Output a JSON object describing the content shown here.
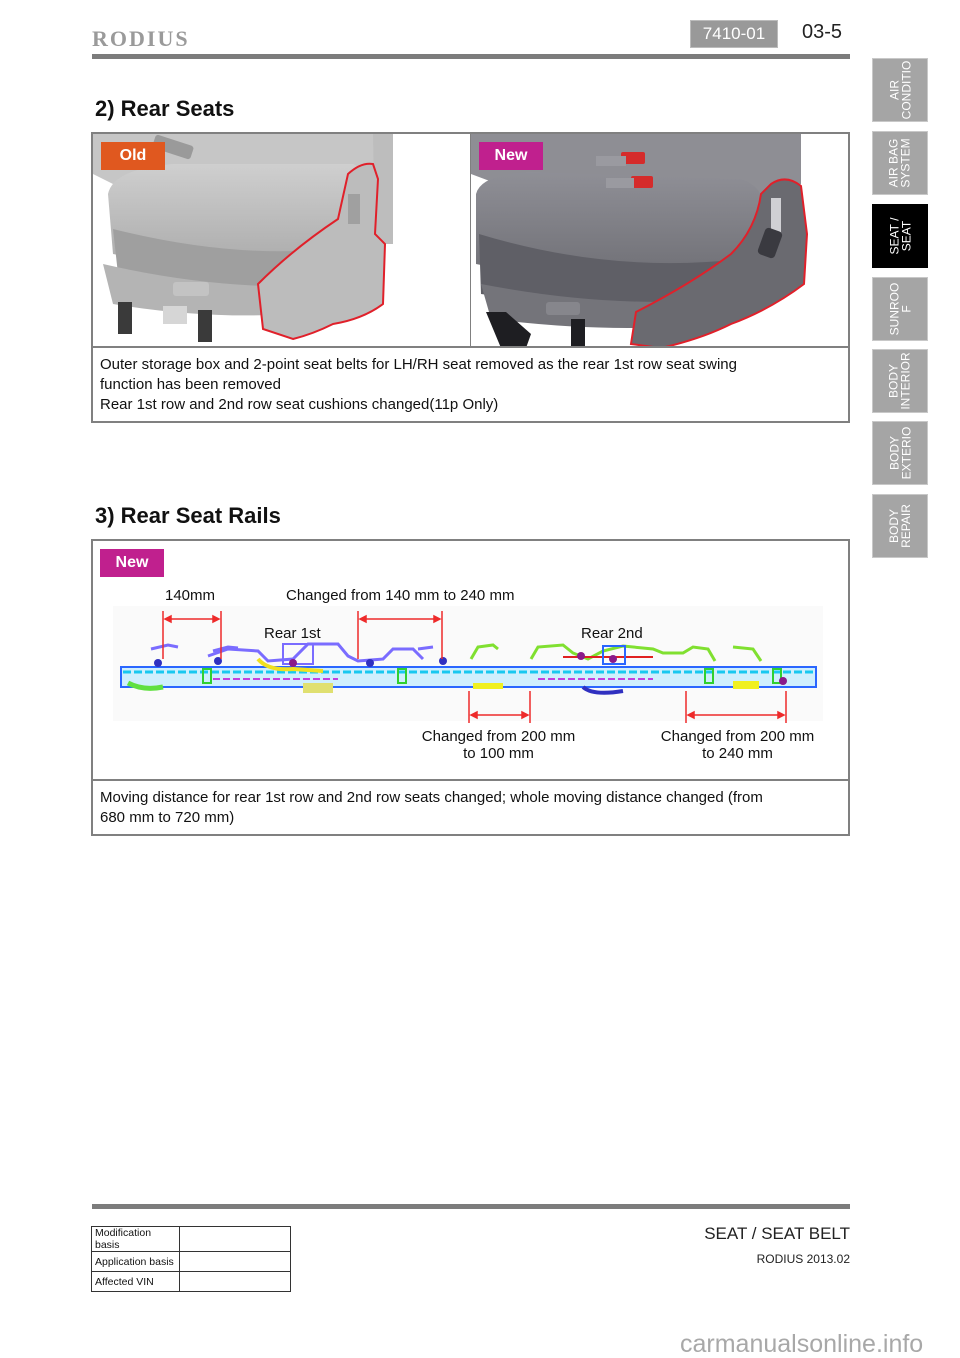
{
  "header": {
    "brand": "RODIUS",
    "code": "7410-01",
    "page": "03-5"
  },
  "side_tabs": [
    {
      "label": "AIR\nCONDITIO",
      "active": false
    },
    {
      "label": "AIR BAG\nSYSTEM",
      "active": false
    },
    {
      "label": "SEAT /\nSEAT",
      "active": true
    },
    {
      "label": "SUNROO\nF",
      "active": false
    },
    {
      "label": "BODY\nINTERIOR",
      "active": false
    },
    {
      "label": "BODY\nEXTERIO",
      "active": false
    },
    {
      "label": "BODY\nREPAIR",
      "active": false
    }
  ],
  "section_rear_seats": {
    "title": "2) Rear Seats",
    "old_tag": "Old",
    "new_tag": "New",
    "old_photo": "old-rear-seat-photo",
    "new_photo": "new-rear-seat-photo",
    "note_lines": [
      "Outer storage box and 2-point seat belts for LH/RH seat removed as the rear 1st row seat swing",
      "function has been removed",
      "Rear 1st row and 2nd row seat cushions changed(11p Only)"
    ]
  },
  "section_rear_rails": {
    "title": "3) Rear Seat Rails",
    "new_tag": "New",
    "labels": {
      "dim_140": "140mm",
      "changed_140_240": "Changed from 140 mm to 240 mm",
      "rear_1st": "Rear 1st",
      "rear_2nd": "Rear 2nd",
      "changed_200_100_l1": "Changed from 200 mm",
      "changed_200_100_l2": "to 100 mm",
      "changed_200_240_l1": "Changed from 200 mm",
      "changed_200_240_l2": "to 240 mm"
    },
    "note_lines": [
      "Moving distance for rear 1st row and 2nd row seats changed; whole moving distance changed (from",
      "680 mm to 720 mm)"
    ]
  },
  "footer": {
    "mod_table": [
      {
        "label": "Modification basis",
        "value": ""
      },
      {
        "label": "Application basis",
        "value": ""
      },
      {
        "label": "Affected VIN",
        "value": ""
      }
    ],
    "section": "SEAT / SEAT BELT",
    "model": "RODIUS 2013.02",
    "watermark": "carmanualsonline.info"
  },
  "colors": {
    "old_tag": "#e0581f",
    "new_tag": "#c0208e",
    "highlight_outline": "#e0202a",
    "dimension_line": "#ee2a2a",
    "tab_inactive": "#a5a5a5",
    "tab_active": "#000000"
  }
}
